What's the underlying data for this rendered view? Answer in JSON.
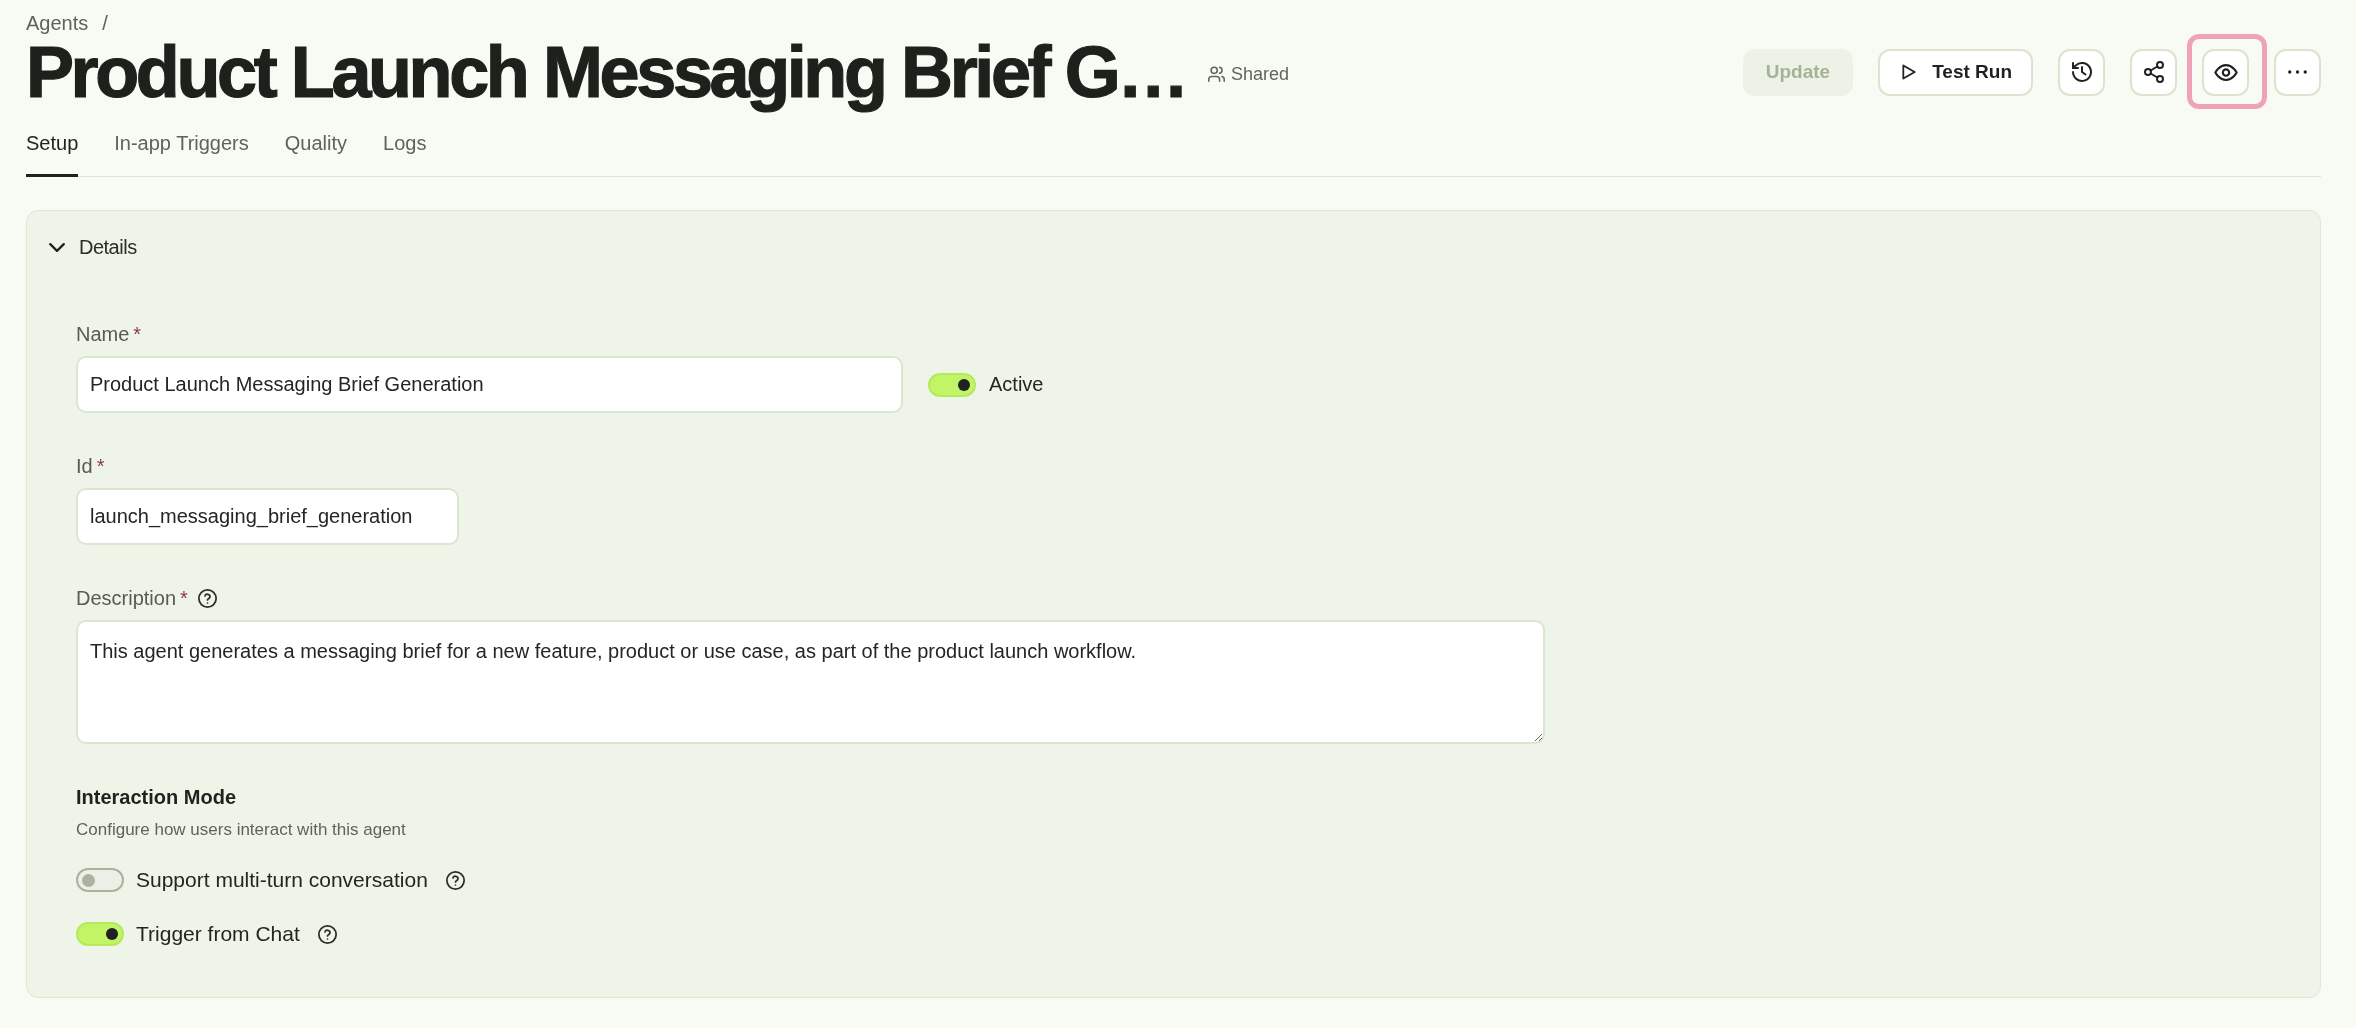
{
  "breadcrumb": {
    "items": [
      {
        "label": "Agents"
      }
    ],
    "separator": "/"
  },
  "title": "Product Launch Messaging Brief G…",
  "sharing": {
    "label": "Shared"
  },
  "actions": [
    {
      "kind": "update",
      "label": "Update",
      "disabled": true,
      "highlighted": false
    },
    {
      "kind": "run",
      "label": "Test Run",
      "disabled": false,
      "highlighted": false
    },
    {
      "kind": "history",
      "disabled": false,
      "highlighted": false
    },
    {
      "kind": "share",
      "disabled": false,
      "highlighted": false
    },
    {
      "kind": "preview",
      "disabled": false,
      "highlighted": true
    },
    {
      "kind": "more",
      "disabled": false,
      "highlighted": false
    }
  ],
  "tabs": [
    {
      "label": "Setup",
      "selected": true
    },
    {
      "label": "In-app Triggers",
      "selected": false
    },
    {
      "label": "Quality",
      "selected": false
    },
    {
      "label": "Logs",
      "selected": false
    }
  ],
  "details": {
    "title": "Details",
    "expanded": true,
    "name": {
      "label": "Name",
      "required_mark": "*",
      "help": false,
      "value": "Product Launch Messaging Brief Generation",
      "toggle": {
        "label": "Active",
        "on": true
      }
    },
    "id": {
      "label": "Id",
      "required_mark": "*",
      "help": false,
      "value": "launch_messaging_brief_generation"
    },
    "description": {
      "label": "Description",
      "required_mark": "*",
      "help": true,
      "value": "This agent generates a messaging brief for a new feature, product or use case, as part of the product launch workflow."
    },
    "interaction_mode": {
      "title": "Interaction Mode",
      "description": "Configure how users interact with this agent",
      "options": [
        {
          "label": "Support multi-turn conversation",
          "on": false,
          "help": true
        },
        {
          "label": "Trigger from Chat",
          "on": true,
          "help": true
        }
      ]
    }
  }
}
